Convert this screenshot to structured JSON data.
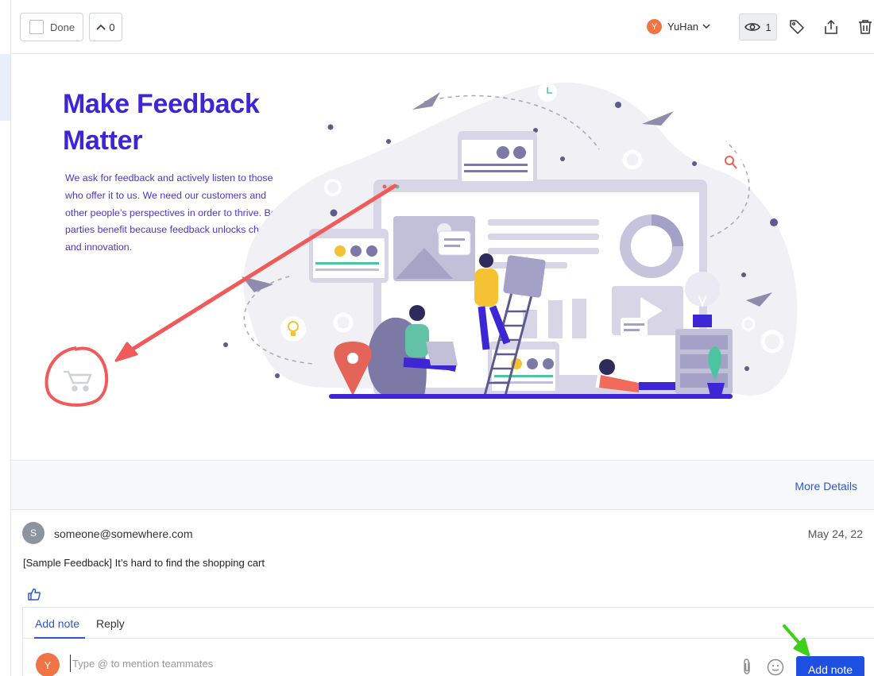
{
  "toolbar": {
    "done_label": "Done",
    "vote_count": "0",
    "assignee_initial": "Y",
    "assignee_name": "YuHan",
    "watch_count": "1"
  },
  "hero": {
    "title_line1": "Make Feedback",
    "title_line2": "Matter",
    "body": "We ask for feedback and actively listen to those who offer it to us. We need our customers and other people’s perspectives in order to thrive. Both parties benefit because feedback unlocks change and innovation."
  },
  "details": {
    "more_label": "More Details"
  },
  "comment": {
    "author_initial": "S",
    "author": "someone@somewhere.com",
    "date": "May 24, 22",
    "text": "[Sample Feedback] It’s hard to find the shopping cart"
  },
  "note": {
    "tabs": [
      "Add note",
      "Reply"
    ],
    "user_initial": "Y",
    "placeholder": "Type @ to mention teammates",
    "submit_label": "Add note"
  },
  "colors": {
    "brand_title": "#3d26d4",
    "accent_blue": "#1e4fe0",
    "annotation_red": "#f05a5a",
    "annotation_green": "#3ecf1a",
    "avatar_orange": "#ef7446"
  },
  "icons": {
    "watch": "eye-icon",
    "tag": "tag-icon",
    "share": "share-icon",
    "delete": "trash-icon",
    "like": "thumbs-up-icon",
    "attach": "paperclip-icon",
    "emoji": "smiley-icon"
  }
}
